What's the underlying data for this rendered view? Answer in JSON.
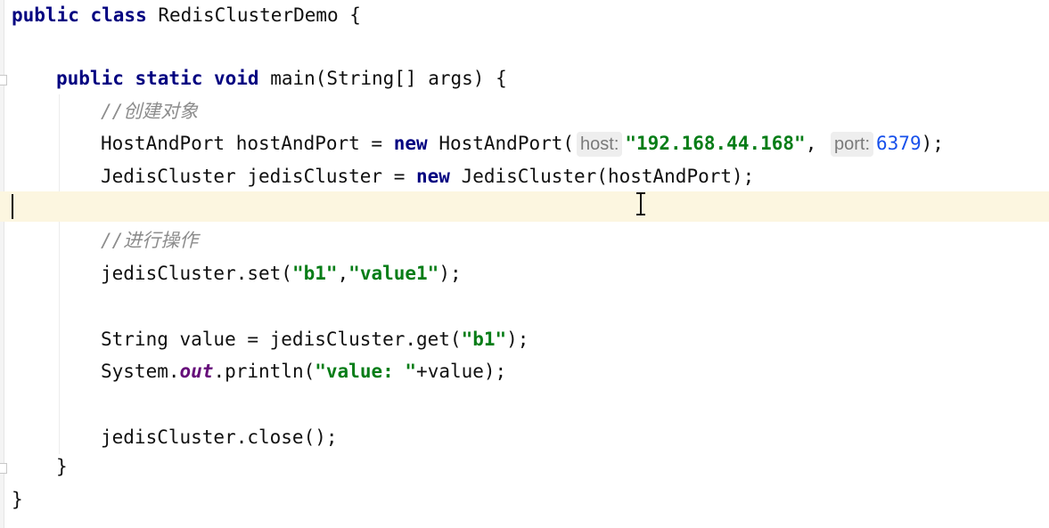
{
  "editor": {
    "lines": [
      {
        "id": "class-decl",
        "tokens": [
          {
            "t": "public class ",
            "c": "kw"
          },
          {
            "t": "RedisClusterDemo {",
            "c": "plain"
          }
        ]
      },
      {
        "id": "blank-1",
        "tokens": []
      },
      {
        "id": "main-decl",
        "tokens": [
          {
            "t": "public static void ",
            "c": "kw"
          },
          {
            "t": "main(String[] args) {",
            "c": "plain"
          }
        ]
      },
      {
        "id": "comment-create",
        "tokens": [
          {
            "t": "//创建对象",
            "c": "cm"
          }
        ]
      },
      {
        "id": "hostandport-line",
        "tokens": [
          {
            "t": "HostAndPort hostAndPort = ",
            "c": "plain"
          },
          {
            "t": "new ",
            "c": "kw"
          },
          {
            "t": "HostAndPort(",
            "c": "plain"
          },
          {
            "t": "host:",
            "c": "hint"
          },
          {
            "t": "\"192.168.44.168\"",
            "c": "str"
          },
          {
            "t": ", ",
            "c": "plain"
          },
          {
            "t": "port:",
            "c": "hint"
          },
          {
            "t": "6379",
            "c": "num"
          },
          {
            "t": ");",
            "c": "plain"
          }
        ]
      },
      {
        "id": "jediscluster-line",
        "tokens": [
          {
            "t": "JedisCluster jedisCluster = ",
            "c": "plain"
          },
          {
            "t": "new ",
            "c": "kw"
          },
          {
            "t": "JedisCluster(hostAndPort);",
            "c": "plain"
          }
        ]
      },
      {
        "id": "caret-line",
        "tokens": []
      },
      {
        "id": "comment-ops",
        "tokens": [
          {
            "t": "//进行操作",
            "c": "cm"
          }
        ]
      },
      {
        "id": "set-line",
        "tokens": [
          {
            "t": "jedisCluster.set(",
            "c": "plain"
          },
          {
            "t": "\"b1\"",
            "c": "str"
          },
          {
            "t": ",",
            "c": "plain"
          },
          {
            "t": "\"value1\"",
            "c": "str"
          },
          {
            "t": ");",
            "c": "plain"
          }
        ]
      },
      {
        "id": "blank-2",
        "tokens": []
      },
      {
        "id": "get-line",
        "tokens": [
          {
            "t": "String value = jedisCluster.get(",
            "c": "plain"
          },
          {
            "t": "\"b1\"",
            "c": "str"
          },
          {
            "t": ");",
            "c": "plain"
          }
        ]
      },
      {
        "id": "println-line",
        "tokens": [
          {
            "t": "System.",
            "c": "plain"
          },
          {
            "t": "out",
            "c": "field"
          },
          {
            "t": ".println(",
            "c": "plain"
          },
          {
            "t": "\"value: \"",
            "c": "str"
          },
          {
            "t": "+value);",
            "c": "plain"
          }
        ]
      },
      {
        "id": "blank-3",
        "tokens": []
      },
      {
        "id": "close-line",
        "tokens": [
          {
            "t": "jedisCluster.close();",
            "c": "plain"
          }
        ]
      },
      {
        "id": "main-close",
        "tokens": [
          {
            "t": "}",
            "c": "plain"
          }
        ]
      },
      {
        "id": "class-close",
        "tokens": [
          {
            "t": "}",
            "c": "plain"
          }
        ]
      }
    ]
  }
}
